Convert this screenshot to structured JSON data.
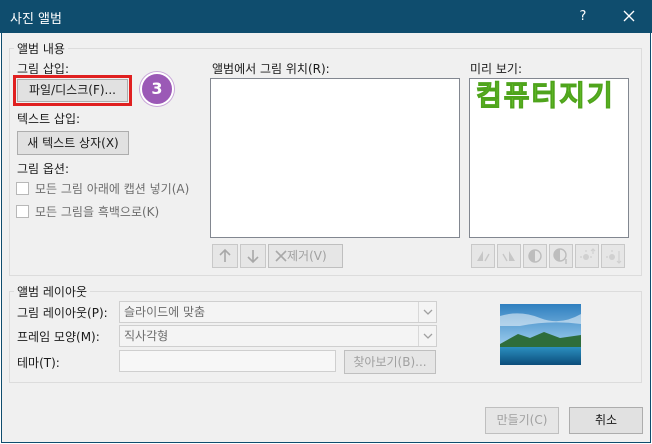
{
  "window": {
    "title": "사진 앨범",
    "help": "?"
  },
  "album_content": {
    "legend": "앨범 내용",
    "insert_picture_label": "그림 삽입:",
    "file_disk_button": "파일/디스크(F)...",
    "insert_text_label": "텍스트 삽입:",
    "new_textbox_button": "새 텍스트 상자(X)",
    "picture_options_label": "그림 옵션:",
    "captions_checkbox": "모든 그림 아래에 캡션 넣기(A)",
    "bw_checkbox": "모든 그림을 흑백으로(K)",
    "pictures_in_album_label": "앨범에서 그림 위치(R):",
    "remove_button": "제거(V)",
    "preview_label": "미리 보기:"
  },
  "annotation": {
    "step_badge": "3",
    "badge_color": "#9b59b6",
    "highlight_color": "#e02020"
  },
  "watermark": "컴퓨터지기",
  "album_layout": {
    "legend": "앨범 레이아웃",
    "picture_layout_label": "그림 레이아웃(P):",
    "picture_layout_value": "슬라이드에 맞춤",
    "frame_shape_label": "프레임 모양(M):",
    "frame_shape_value": "직사각형",
    "theme_label": "테마(T):",
    "theme_value": "",
    "browse_button": "찾아보기(B)..."
  },
  "footer": {
    "create_button": "만들기(C)",
    "cancel_button": "취소"
  },
  "icons": {
    "move_up": "arrow-up-icon",
    "move_down": "arrow-down-icon",
    "remove": "x-icon",
    "preview_tools": [
      "rotate-left-icon",
      "rotate-right-icon",
      "contrast-up-icon",
      "contrast-down-icon",
      "brightness-up-icon",
      "brightness-down-icon"
    ]
  },
  "colors": {
    "titlebar": "#0f4d6e",
    "dialog_bg": "#f0f0f0"
  }
}
